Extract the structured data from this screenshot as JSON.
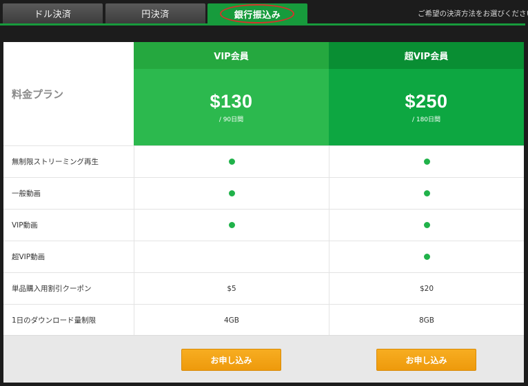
{
  "tabs": [
    {
      "label": "ドル決済",
      "active": false
    },
    {
      "label": "円決済",
      "active": false
    },
    {
      "label": "銀行振込み",
      "active": true
    }
  ],
  "hint": "ご希望の決済方法をお選びください",
  "table": {
    "label_header": "料金プラン",
    "plans": [
      {
        "name": "VIP会員",
        "price": "$130",
        "period": "/ 90日間"
      },
      {
        "name": "超VIP会員",
        "price": "$250",
        "period": "/ 180日間"
      }
    ],
    "rows": [
      {
        "label": "無制限ストリーミング再生",
        "vip": "dot",
        "super": "dot"
      },
      {
        "label": "一般動画",
        "vip": "dot",
        "super": "dot"
      },
      {
        "label": "VIP動画",
        "vip": "dot",
        "super": "dot"
      },
      {
        "label": "超VIP動画",
        "vip": "",
        "super": "dot"
      },
      {
        "label": "単品購入用割引クーポン",
        "vip": "$5",
        "super": "$20"
      },
      {
        "label": "1日のダウンロード量制限",
        "vip": "4GB",
        "super": "8GB"
      }
    ],
    "apply_label": "お申し込み"
  },
  "colors": {
    "accent_green": "#179b3c",
    "dot_green": "#20b24a",
    "apply_orange": "#f7ad21",
    "highlight_red": "#d8312b"
  }
}
